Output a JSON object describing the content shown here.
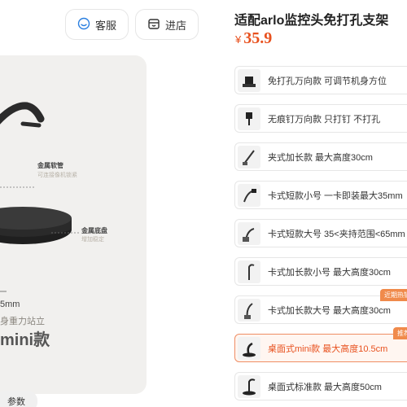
{
  "header": {
    "service_label": "客服",
    "store_label": "进店"
  },
  "product": {
    "title": "适配arlo监控头免打孔支架",
    "currency": "¥",
    "price": "35.9"
  },
  "gallery": {
    "callout_hose": "金属软管",
    "callout_hose_sub": "可连接像机锁紧",
    "callout_base": "金属底盘",
    "callout_base_sub": "增加稳定",
    "dimension": "5mm",
    "stand_caption": "身重力站立",
    "model_caption": "mini款",
    "param_tab": "参数"
  },
  "options": [
    {
      "label": "免打孔万向款 可调节机身方位"
    },
    {
      "label": "无痕钉万向款 只打钉 不打孔"
    },
    {
      "label": "夹式加长款 最大高度30cm"
    },
    {
      "label": "卡式短款小号 一卡即装最大35mm"
    },
    {
      "label": "卡式短款大号 35<夹持范围<65mm"
    },
    {
      "label": "卡式加长款小号 最大高度30cm"
    },
    {
      "label": "卡式加长款大号 最大高度30cm",
      "badge": "近期热销"
    },
    {
      "label": "桌面式mini款 最大高度10.5cm",
      "badge": "推荐",
      "selected": true
    },
    {
      "label": "桌面式标准款 最大高度50cm"
    }
  ],
  "colors": {
    "accent": "#e8511e",
    "badge": "#f08a4b",
    "selected_border": "#ef8d63"
  }
}
